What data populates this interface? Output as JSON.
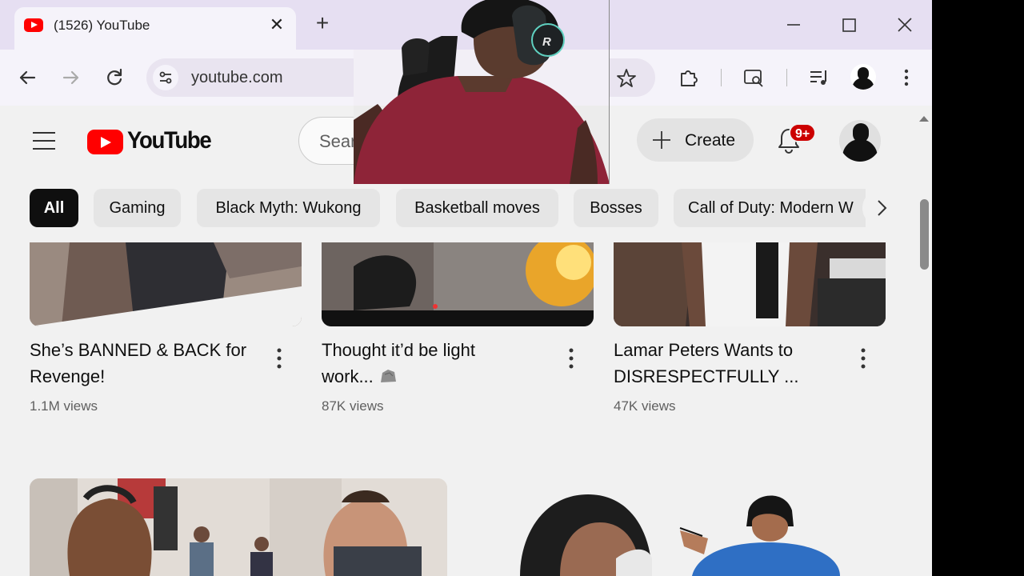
{
  "browser": {
    "tab": {
      "title": "(1526) YouTube"
    },
    "url": "youtube.com"
  },
  "youtube": {
    "logo_text": "YouTube",
    "search_placeholder": "Search",
    "create_label": "Create",
    "notification_badge": "9+",
    "chips": [
      {
        "label": "All",
        "active": true
      },
      {
        "label": "Gaming"
      },
      {
        "label": "Black Myth: Wukong"
      },
      {
        "label": "Basketball moves"
      },
      {
        "label": "Bosses"
      },
      {
        "label": "Call of Duty: Modern W"
      }
    ],
    "videos": [
      {
        "title_line1": "She’s BANNED & BACK for",
        "title_line2": "Revenge!",
        "views": "1.1M views"
      },
      {
        "title_line1": "Thought it’d be light",
        "title_line2": "work...",
        "views": "87K views"
      },
      {
        "title_line1": "Lamar Peters Wants to",
        "title_line2": "DISRESPECTFULLY ...",
        "views": "47K views"
      }
    ],
    "webcam_headset_letter": "R"
  },
  "colors": {
    "brand_red": "#ff0000",
    "badge_red": "#cc0000",
    "tabstrip": "#e6dff2",
    "page_bg": "#f1f1f1"
  }
}
